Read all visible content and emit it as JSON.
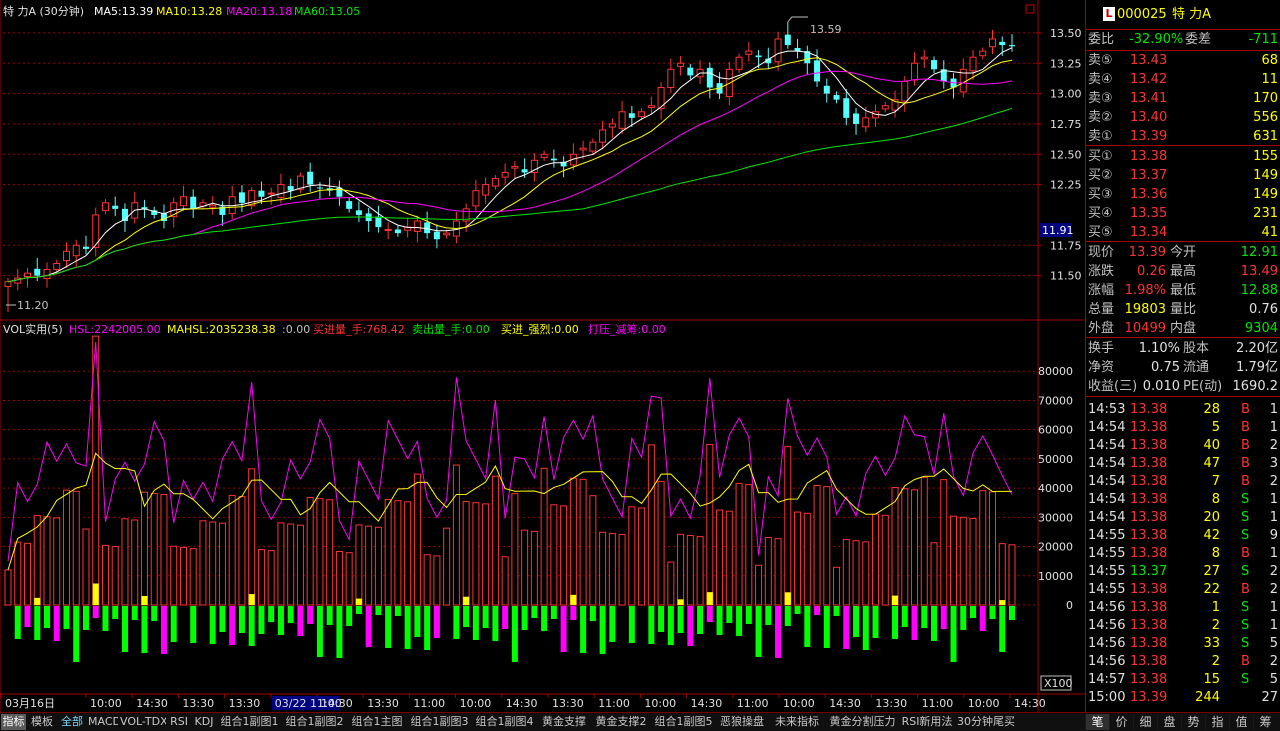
{
  "header": {
    "title": "特  力A (30分钟)",
    "ma5": "MA5:13.39",
    "ma10": "MA10:13.28",
    "ma20": "MA20:13.18",
    "ma60": "MA60:13.05"
  },
  "price_axis": [
    "13.50",
    "13.25",
    "13.00",
    "12.75",
    "12.50",
    "12.25",
    "11.75",
    "11.50"
  ],
  "price_marker": "11.91",
  "high_label": "13.59",
  "low_label": "11.20",
  "vol_header": {
    "name": "VOL实用(5)",
    "hsl": "HSL:2242005.00",
    "mahsl": "MAHSL:2035238.38",
    "zero": ":0.00",
    "buy": "买进量_手:768.42",
    "sell": "卖出量_手:0.00",
    "strong": "买进_强烈:0.00",
    "press": "打压_减筹:0.00"
  },
  "vol_axis": [
    "80000",
    "70000",
    "60000",
    "50000",
    "40000",
    "30000",
    "20000",
    "10000",
    "0"
  ],
  "vol_multiplier": "X100",
  "time_axis": [
    "03月16日",
    "10:00",
    "14:30",
    "13:30",
    "13:30",
    "03/22 11:00",
    "14:30",
    "13:30",
    "11:00",
    "10:00",
    "14:30",
    "13:30",
    "11:00",
    "10:00",
    "14:30",
    "11:00",
    "10:00",
    "14:30",
    "13:30",
    "11:00",
    "10:00",
    "14:30"
  ],
  "chart_data": {
    "type": "candlestick",
    "period": "30分钟",
    "ylim": [
      11.2,
      13.59
    ],
    "high": 13.59,
    "low": 11.2,
    "close_series": [
      11.45,
      11.48,
      11.52,
      11.5,
      11.55,
      11.6,
      11.7,
      11.75,
      11.72,
      12.0,
      12.1,
      12.05,
      11.95,
      12.1,
      12.05,
      12.0,
      11.95,
      12.1,
      12.15,
      12.05,
      12.1,
      12.08,
      12.0,
      12.15,
      12.1,
      12.2,
      12.15,
      12.18,
      12.25,
      12.2,
      12.32,
      12.25,
      12.22,
      12.2,
      12.15,
      12.05,
      12.0,
      11.95,
      11.9,
      11.88,
      11.85,
      11.9,
      11.95,
      11.85,
      11.8,
      11.85,
      11.95,
      12.05,
      12.2,
      12.25,
      12.3,
      12.35,
      12.4,
      12.35,
      12.45,
      12.5,
      12.45,
      12.4,
      12.5,
      12.55,
      12.6,
      12.7,
      12.75,
      12.85,
      12.8,
      12.85,
      12.9,
      13.05,
      13.2,
      13.25,
      13.15,
      13.2,
      13.05,
      13.0,
      13.2,
      13.3,
      13.35,
      13.3,
      13.25,
      13.45,
      13.4,
      13.35,
      13.25,
      13.1,
      13.0,
      12.95,
      12.8,
      12.75,
      12.8,
      12.85,
      12.9,
      12.95,
      13.1,
      13.25,
      13.3,
      13.2,
      13.1,
      13.05,
      13.2,
      13.3,
      13.35,
      13.45,
      13.4,
      13.39
    ],
    "ma_series": [
      "MA5",
      "MA10",
      "MA20",
      "MA60"
    ],
    "volume_series": [
      "HSL",
      "MAHSL",
      "买进量_手",
      "卖出量_手",
      "买进_强烈",
      "打压_减筹"
    ]
  },
  "quote": {
    "badge": "L",
    "code": "000025",
    "name": "特  力A",
    "weibi_label": "委比",
    "weibi_value": "-32.90%",
    "weicha_label": "委差",
    "weicha_value": "-711",
    "sells": [
      {
        "label": "卖⑤",
        "price": "13.43",
        "vol": "68"
      },
      {
        "label": "卖④",
        "price": "13.42",
        "vol": "11"
      },
      {
        "label": "卖③",
        "price": "13.41",
        "vol": "170"
      },
      {
        "label": "卖②",
        "price": "13.40",
        "vol": "556"
      },
      {
        "label": "卖①",
        "price": "13.39",
        "vol": "631"
      }
    ],
    "buys": [
      {
        "label": "买①",
        "price": "13.38",
        "vol": "155"
      },
      {
        "label": "买②",
        "price": "13.37",
        "vol": "149"
      },
      {
        "label": "买③",
        "price": "13.36",
        "vol": "149"
      },
      {
        "label": "买④",
        "price": "13.35",
        "vol": "231"
      },
      {
        "label": "买⑤",
        "price": "13.34",
        "vol": "41"
      }
    ],
    "stats": [
      {
        "l1": "现价",
        "v1": "13.39",
        "l2": "今开",
        "v2": "12.91"
      },
      {
        "l1": "涨跌",
        "v1": "0.26",
        "l2": "最高",
        "v2": "13.49"
      },
      {
        "l1": "涨幅",
        "v1": "1.98%",
        "l2": "最低",
        "v2": "12.88"
      },
      {
        "l1": "总量",
        "v1": "19803",
        "l2": "量比",
        "v2": "0.76"
      },
      {
        "l1": "外盘",
        "v1": "10499",
        "l2": "内盘",
        "v2": "9304"
      }
    ],
    "extra": [
      {
        "l1": "换手",
        "v1": "1.10%",
        "l2": "股本",
        "v2": "2.20亿"
      },
      {
        "l1": "净资",
        "v1": "0.75",
        "l2": "流通",
        "v2": "1.79亿"
      },
      {
        "l1": "收益(三)",
        "v1": "0.010",
        "l2": "PE(动)",
        "v2": "1690.2"
      }
    ]
  },
  "ticks": [
    {
      "time": "14:53",
      "price": "13.38",
      "vol": "28",
      "side": "B",
      "n": "1"
    },
    {
      "time": "14:54",
      "price": "13.38",
      "vol": "5",
      "side": "B",
      "n": "1"
    },
    {
      "time": "14:54",
      "price": "13.38",
      "vol": "40",
      "side": "B",
      "n": "2"
    },
    {
      "time": "14:54",
      "price": "13.38",
      "vol": "47",
      "side": "B",
      "n": "3"
    },
    {
      "time": "14:54",
      "price": "13.38",
      "vol": "7",
      "side": "B",
      "n": "2"
    },
    {
      "time": "14:54",
      "price": "13.38",
      "vol": "8",
      "side": "S",
      "n": "1"
    },
    {
      "time": "14:54",
      "price": "13.38",
      "vol": "20",
      "side": "S",
      "n": "1"
    },
    {
      "time": "14:55",
      "price": "13.38",
      "vol": "42",
      "side": "S",
      "n": "9"
    },
    {
      "time": "14:55",
      "price": "13.38",
      "vol": "8",
      "side": "B",
      "n": "1"
    },
    {
      "time": "14:55",
      "price": "13.37",
      "vol": "27",
      "side": "S",
      "n": "2"
    },
    {
      "time": "14:55",
      "price": "13.38",
      "vol": "22",
      "side": "B",
      "n": "2"
    },
    {
      "time": "14:56",
      "price": "13.38",
      "vol": "1",
      "side": "S",
      "n": "1"
    },
    {
      "time": "14:56",
      "price": "13.38",
      "vol": "2",
      "side": "S",
      "n": "1"
    },
    {
      "time": "14:56",
      "price": "13.38",
      "vol": "33",
      "side": "S",
      "n": "5"
    },
    {
      "time": "14:56",
      "price": "13.38",
      "vol": "2",
      "side": "B",
      "n": "2"
    },
    {
      "time": "14:57",
      "price": "13.38",
      "vol": "15",
      "side": "S",
      "n": "5"
    },
    {
      "time": "15:00",
      "price": "13.39",
      "vol": "244",
      "side": "",
      "n": "27"
    }
  ],
  "toolbar": [
    "指标",
    "模板",
    "全部",
    "MACD",
    "VOL-TDX",
    "RSI",
    "KDJ",
    "组合1副图1",
    "组合1副图2",
    "组合1主图",
    "组合1副图3",
    "组合1副图4",
    "黄金支撑",
    "黄金支撑2",
    "组合1副图5",
    "恶狼操盘",
    "未来指标",
    "黄金分割压力",
    "RSI新用法",
    "30分钟尾买"
  ],
  "right_tabs": [
    "笔",
    "价",
    "细",
    "盘",
    "势",
    "指",
    "值",
    "筹"
  ],
  "colors": {
    "up": "#ff3232",
    "down": "#54ffff",
    "ma5": "#ffffff",
    "ma10": "#ffff00",
    "ma20": "#ff00ff",
    "ma60": "#00e600",
    "grid": "#a00000"
  }
}
